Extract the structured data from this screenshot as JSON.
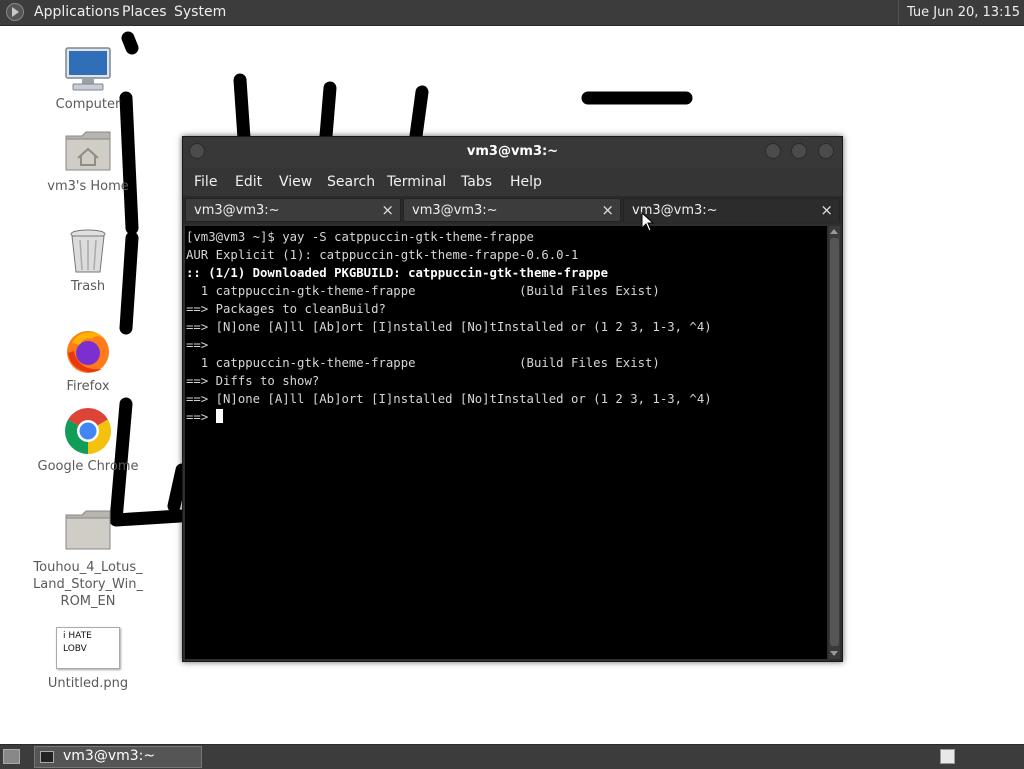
{
  "top_panel": {
    "menus": [
      "Applications",
      "Places",
      "System"
    ],
    "clock": "Tue Jun 20, 13:15"
  },
  "desktop": {
    "icons": [
      {
        "label": "Computer",
        "icon": "computer-icon"
      },
      {
        "label": "vm3's Home",
        "icon": "home-folder-icon"
      },
      {
        "label": "Trash",
        "icon": "trash-icon"
      },
      {
        "label": "Firefox",
        "icon": "firefox-icon"
      },
      {
        "label": "Google Chrome",
        "icon": "chrome-icon"
      },
      {
        "label": "Touhou_4_Lotus_Land_Story_Win_ROM_EN",
        "display_lines": [
          "Touhou_4_Lotus_",
          "Land_Story_Win_",
          "ROM_EN"
        ],
        "icon": "folder-icon"
      },
      {
        "label": "Untitled.png",
        "icon": "image-thumbnail-icon",
        "thumbnail_text": [
          "i HATE",
          "LOBV"
        ]
      }
    ],
    "wallpaper_scribble": "i HATE LO"
  },
  "terminal_window": {
    "title": "vm3@vm3:~",
    "menu": [
      "File",
      "Edit",
      "View",
      "Search",
      "Terminal",
      "Tabs",
      "Help"
    ],
    "tabs": [
      {
        "label": "vm3@vm3:~",
        "active": false
      },
      {
        "label": "vm3@vm3:~",
        "active": false
      },
      {
        "label": "vm3@vm3:~",
        "active": true
      }
    ],
    "tab_close": "×",
    "lines": [
      {
        "text": "[vm3@vm3 ~]$ yay -S catppuccin-gtk-theme-frappe",
        "bold": false
      },
      {
        "text": "AUR Explicit (1): catppuccin-gtk-theme-frappe-0.6.0-1",
        "bold": false
      },
      {
        "text": ":: (1/1) Downloaded PKGBUILD: catppuccin-gtk-theme-frappe",
        "bold": true
      },
      {
        "text": "  1 catppuccin-gtk-theme-frappe              (Build Files Exist)",
        "bold": false
      },
      {
        "text": "==> Packages to cleanBuild?",
        "bold": false
      },
      {
        "text": "==> [N]one [A]ll [Ab]ort [I]nstalled [No]tInstalled or (1 2 3, 1-3, ^4)",
        "bold": false
      },
      {
        "text": "==> ",
        "bold": false
      },
      {
        "text": "  1 catppuccin-gtk-theme-frappe              (Build Files Exist)",
        "bold": false
      },
      {
        "text": "==> Diffs to show?",
        "bold": false
      },
      {
        "text": "==> [N]one [A]ll [Ab]ort [I]nstalled [No]tInstalled or (1 2 3, 1-3, ^4)",
        "bold": false
      }
    ],
    "prompt": "==> "
  },
  "bottom_panel": {
    "task_label": "vm3@vm3:~"
  }
}
